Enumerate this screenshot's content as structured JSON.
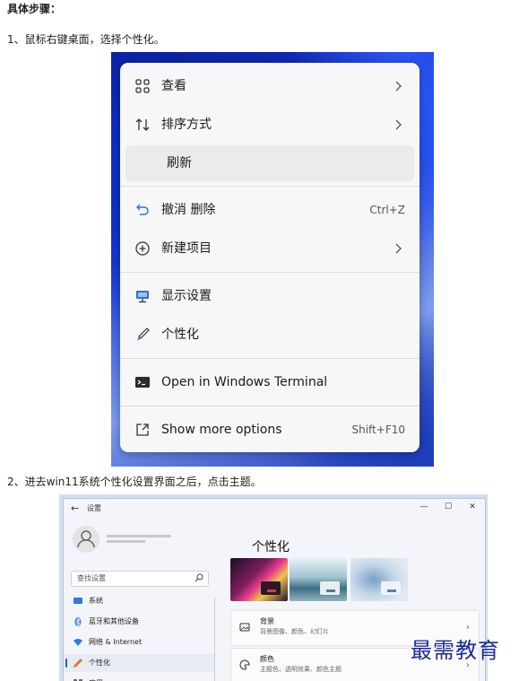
{
  "heading": "具体步骤：",
  "step1": "1、鼠标右键桌面，选择个性化。",
  "step2": "2、进去win11系统个性化设置界面之后，点击主题。",
  "context_menu": {
    "items": [
      {
        "label": "查看",
        "icon": "grid-icon",
        "submenu": true
      },
      {
        "label": "排序方式",
        "icon": "sort-icon",
        "submenu": true
      },
      {
        "label": "刷新",
        "icon": "",
        "highlighted": true
      },
      {
        "label": "撤消 删除",
        "icon": "undo-icon",
        "shortcut": "Ctrl+Z"
      },
      {
        "label": "新建项目",
        "icon": "new-plus-icon",
        "submenu": true
      },
      {
        "label": "显示设置",
        "icon": "display-icon"
      },
      {
        "label": "个性化",
        "icon": "brush-icon"
      },
      {
        "label": "Open in Windows Terminal",
        "icon": "terminal-icon"
      },
      {
        "label": "Show more options",
        "icon": "more-options-icon",
        "shortcut": "Shift+F10"
      }
    ]
  },
  "settings": {
    "window_title": "设置",
    "back_glyph": "←",
    "controls": [
      "—",
      "☐",
      "✕"
    ],
    "search_placeholder": "查找设置",
    "nav": [
      {
        "label": "系统",
        "icon": "system-icon",
        "color": "#2f7ae5"
      },
      {
        "label": "蓝牙和其他设备",
        "icon": "bluetooth-icon",
        "color": "#2f7ae5"
      },
      {
        "label": "网络 & Internet",
        "icon": "wifi-icon",
        "color": "#2f7ae5"
      },
      {
        "label": "个性化",
        "icon": "pen-icon",
        "color": "#d07b2a",
        "selected": true
      },
      {
        "label": "应用",
        "icon": "apps-icon",
        "color": "#6a6a6a"
      }
    ],
    "page_title": "个性化",
    "cards": [
      {
        "title": "背景",
        "subtitle": "背景图像、颜色、幻灯片",
        "icon": "image-icon"
      },
      {
        "title": "颜色",
        "subtitle": "主题色、透明效果、颜色主题",
        "icon": "palette-icon"
      }
    ],
    "chevron": "›"
  },
  "watermark": "最需教育",
  "colors": {
    "accent": "#1463d2",
    "watermark": "#1d2a9a"
  }
}
